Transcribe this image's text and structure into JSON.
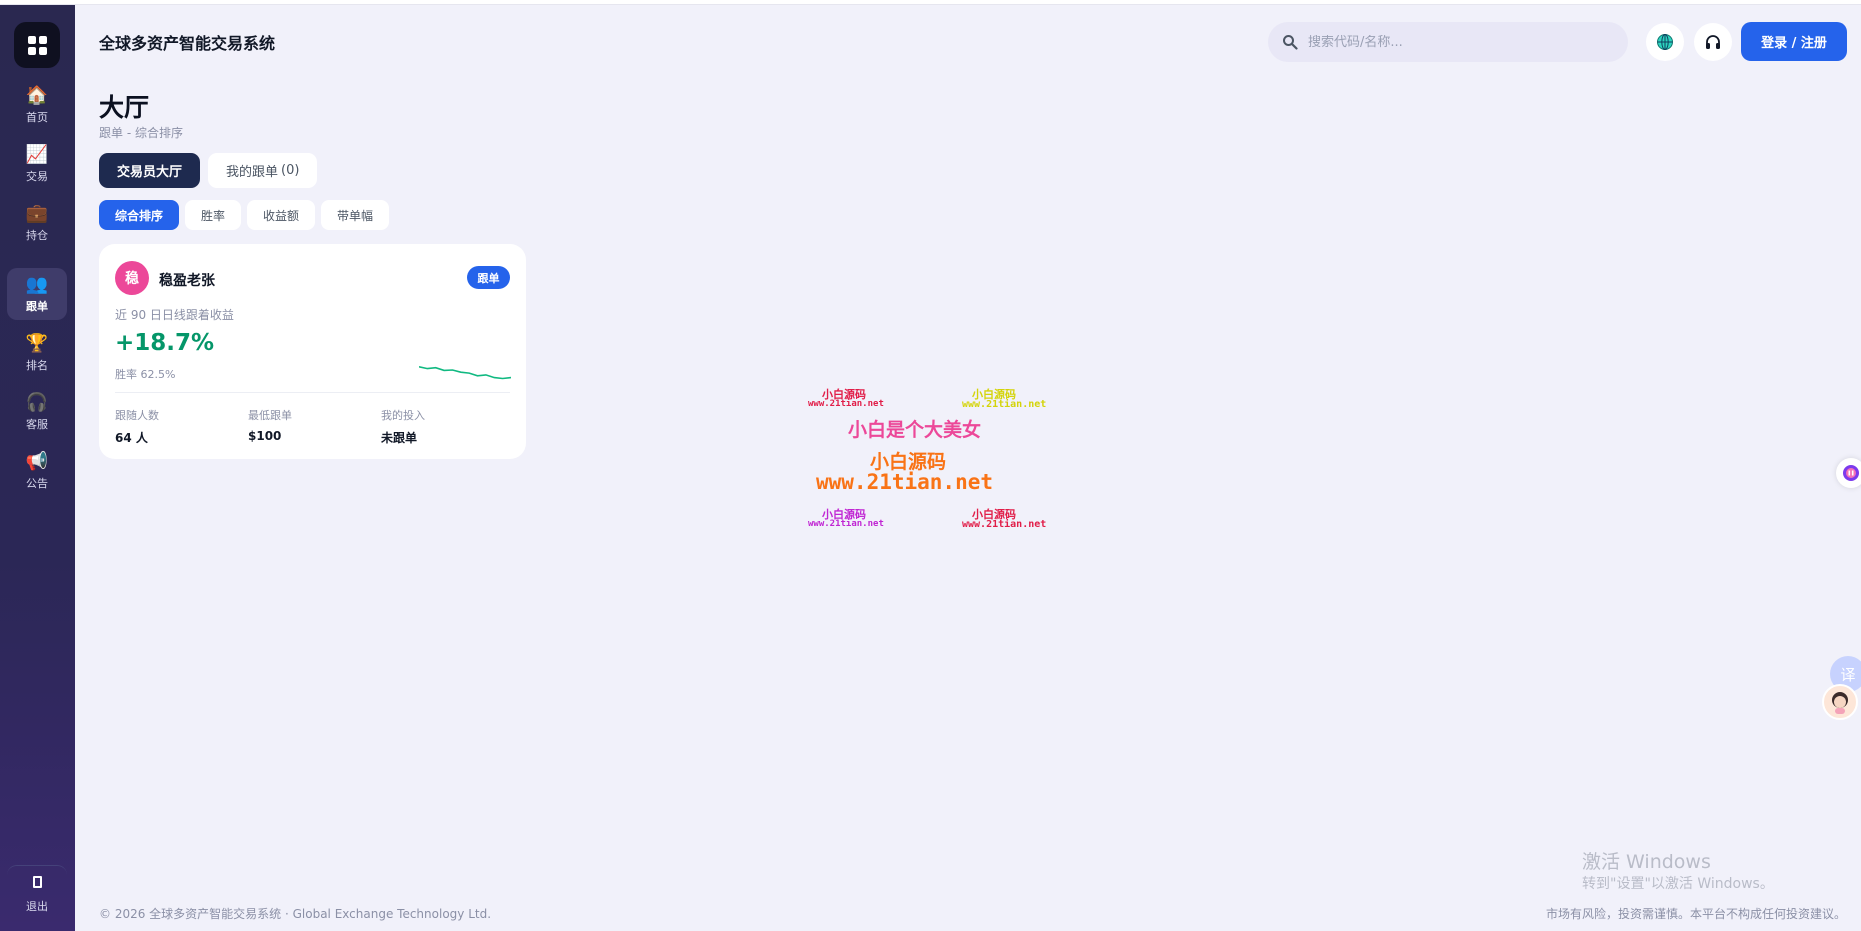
{
  "app": {
    "title": "全球多资产智能交易系统"
  },
  "sidebar": {
    "items": [
      {
        "label": "首页",
        "icon": "home-icon",
        "glyph": "🏠"
      },
      {
        "label": "交易",
        "icon": "chart-icon",
        "glyph": "📈"
      },
      {
        "label": "持仓",
        "icon": "briefcase-icon",
        "glyph": "💼"
      },
      {
        "label": "跟单",
        "icon": "people-icon",
        "glyph": "👥"
      },
      {
        "label": "排名",
        "icon": "trophy-icon",
        "glyph": "🏆"
      },
      {
        "label": "客服",
        "icon": "headset-icon",
        "glyph": "🎧"
      },
      {
        "label": "公告",
        "icon": "megaphone-icon",
        "glyph": "📢"
      }
    ],
    "active": "跟单",
    "logout_label": "退出"
  },
  "header": {
    "search_placeholder": "搜索代码/名称...",
    "login_label": "登录 / 注册"
  },
  "page": {
    "title": "大厅",
    "subtitle": "跟单 - 综合排序"
  },
  "tabs": [
    {
      "label": "交易员大厅",
      "active": true
    },
    {
      "label": "我的跟单",
      "count": "(0)",
      "active": false
    }
  ],
  "sort_options": [
    {
      "label": "综合排序",
      "active": true
    },
    {
      "label": "胜率",
      "active": false
    },
    {
      "label": "收益额",
      "active": false
    },
    {
      "label": "带单幅",
      "active": false
    }
  ],
  "trader_card": {
    "avatar_char": "稳",
    "name": "稳盈老张",
    "follow_label": "跟单",
    "return_label": "近 90 日日线跟着收益",
    "return_value": "+18.7%",
    "win_rate": "胜率 62.5%",
    "sparkline": [
      0.9,
      0.8,
      0.85,
      0.7,
      0.72,
      0.6,
      0.55,
      0.4,
      0.45,
      0.3,
      0.25,
      0.3
    ],
    "stats": [
      {
        "label": "跟随人数",
        "value": "64 人"
      },
      {
        "label": "最低跟单",
        "value": "$100"
      },
      {
        "label": "我的投入",
        "value": "未跟单"
      }
    ]
  },
  "watermark": {
    "line_small": "小白源码",
    "url_small": "www.21tian.net",
    "main": "小白是个大美女",
    "brand": "小白源码",
    "url": "www.21tian.net"
  },
  "floating": {
    "translate_label": "译"
  },
  "system_overlay": {
    "activate_title": "激活 Windows",
    "activate_sub": "转到\"设置\"以激活 Windows。"
  },
  "footer": {
    "copyright": "© 2026 全球多资产智能交易系统 · Global Exchange Technology Ltd.",
    "disclaimer": "市场有风险，投资需谨慎。本平台不构成任何投资建议。"
  },
  "colors": {
    "accent": "#2563eb",
    "positive": "#059669",
    "sidebar": "#2a2850"
  }
}
